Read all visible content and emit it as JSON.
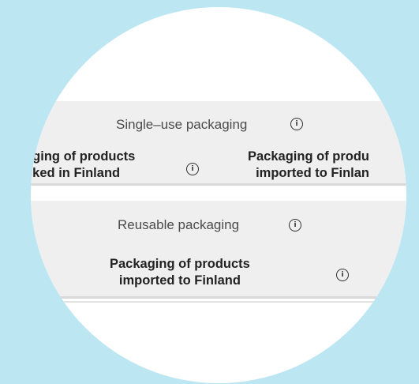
{
  "single_use": {
    "header": "Single–use packaging",
    "left_line1": "aging of products",
    "left_line2": "cked in Finland",
    "right_line1": "Packaging of produ",
    "right_line2": "imported to Finlan"
  },
  "reusable": {
    "header": "Reusable packaging",
    "line1": "Packaging of products",
    "line2": "imported to Finland"
  },
  "icons": {
    "info": "info-icon"
  },
  "colors": {
    "background": "#bde6f3",
    "panel": "#efefef",
    "text": "#222222"
  }
}
